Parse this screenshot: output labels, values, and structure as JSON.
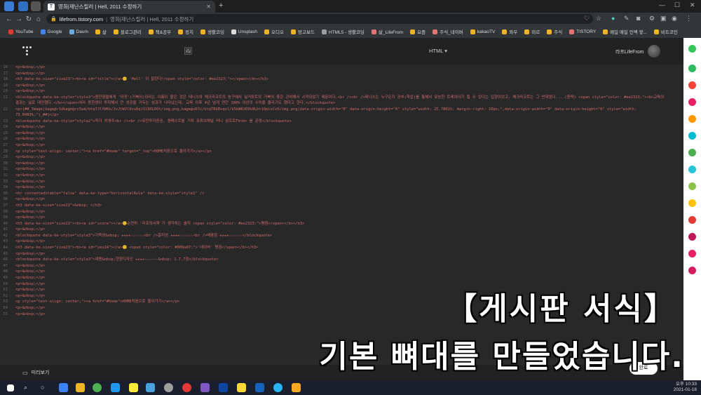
{
  "tab": {
    "title": "영화|재난스릴러 | Hell, 2011 수정하기",
    "favicon": "T"
  },
  "address": {
    "host": "lifefrom.tistory.com",
    "separator": "|",
    "page_title": "영화|재난스릴러 | Hell, 2011 수정하기"
  },
  "bookmarks": [
    {
      "label": "YouTube",
      "color": "#e53935"
    },
    {
      "label": "Google",
      "color": "#4285f4"
    },
    {
      "label": "Daum",
      "color": "#6fa8dc"
    },
    {
      "label": "삶",
      "color": "#f0b323"
    },
    {
      "label": "블로그관리",
      "color": "#f0b323"
    },
    {
      "label": "책&공부",
      "color": "#f0b323"
    },
    {
      "label": "정치",
      "color": "#f0b323"
    },
    {
      "label": "생활코딩",
      "color": "#f0b323"
    },
    {
      "label": "Unsplash",
      "color": "#dddddd"
    },
    {
      "label": "오디오",
      "color": "#f0b323"
    },
    {
      "label": "망고보드",
      "color": "#f0b323"
    },
    {
      "label": "HTML5 - 생활코딩",
      "color": "#9e9e9e"
    },
    {
      "label": "삶_LifeFrom",
      "color": "#e57373"
    },
    {
      "label": "요즘",
      "color": "#f0b323"
    },
    {
      "label": "주식_네이버",
      "color": "#e57373"
    },
    {
      "label": "kakaoTV",
      "color": "#f0b323"
    },
    {
      "label": "와우",
      "color": "#f0b323"
    },
    {
      "label": "미르",
      "color": "#f0b323"
    },
    {
      "label": "주식",
      "color": "#f0b323"
    },
    {
      "label": "TISTORY",
      "color": "#e57373"
    },
    {
      "label": "매일 매일 인맥 쌓...",
      "color": "#f0b323"
    },
    {
      "label": "비트코인",
      "color": "#f0b323"
    }
  ],
  "editor": {
    "mode_label": "HTML",
    "mode_caret": "▾",
    "user_name": "라프LifeFrom",
    "preview_label": "미리보기",
    "save_label": "완료"
  },
  "code_lines": [
    {
      "n": "16",
      "code": "<p>&nbsp;</p>"
    },
    {
      "n": "17",
      "code": "<p>&nbsp;</p>"
    },
    {
      "n": "18",
      "code": "<h3 data-ke-size=\"size23\"><b><a id=\"title\"></a>😊 'Hell' 이 말한다!<span style=\"color: #ee2323;\"></span></b></h3>"
    },
    {
      "n": "19",
      "code": "<p>&nbsp;</p>"
    },
    {
      "n": "20",
      "code": "<p>&nbsp;</p>"
    },
    {
      "n": "21",
      "code": "<blockquote data-ke-style=\"style3\">용한형들에게 '타겟'(거북이)이라는 이름이 붙은 것은 테니스와 헤크라코트의 농구에서 싫거포트의 거북이 좋은 관치해서 시작되었기 때문이다.<br /><br />테니스는 누구든지 공부(학습)를 통해서 유능한 트레이더가 될 수 있다는 입장이었고, 헤크라코트는 그 반대였다....(중략) <span style=\"color: #ee2323;\"><b>교육의 결과는 실로 대단했다.</b></span>여러 종한생이 투자해서 큰 성공을 거두는 성과가 나타났는데, 교육 이후 4년 넘게 연간 100% 이상의 수익을 올리기도 했다고 한다.</blockquote>",
      "wrap": true
    },
    {
      "n": "22",
      "code": "<p>[##_Image|kage@r1dkage@rc5wd/btqTJlYW6k/JvJtWJl9xvDqiSl9XLDOt/img.png,kage@sD7c/btqTRkBxqol/k5kW8JE9k0Lbt1QeisCzO/img.png|data-origin-width=\"0\" data-origin-height=\"0\" style=\"width: 25.7801%; margin-right: 10px;\",data-origin-width=\"0\" data-origin-height=\"0\" style=\"width: 73.0483%;\"|_##]</p>",
      "wrap": true
    },
    {
      "n": "23",
      "code": "<blockquote data-ke-style=\"style2\">작가 차영주<br /><br />유진투자증권, 퀀메스트를 거쳐 유튜브채널 러니 삼프로TV<b> 를 운영</blockquote>"
    },
    {
      "n": "24",
      "code": "<p>&nbsp;</p>"
    },
    {
      "n": "25",
      "code": "<p>&nbsp;</p>"
    },
    {
      "n": "26",
      "code": "<p>&nbsp;</p>"
    },
    {
      "n": "27",
      "code": "<p>&nbsp;</p>"
    },
    {
      "n": "28",
      "code": "<p style=\"text-align: center;\"><a href=\"#home\" target=\"_top\">HOME처음으로 돌아가기</a></p>"
    },
    {
      "n": "29",
      "code": "<p>&nbsp;</p>"
    },
    {
      "n": "30",
      "code": "<p>&nbsp;</p>"
    },
    {
      "n": "31",
      "code": "<p>&nbsp;</p>"
    },
    {
      "n": "32",
      "code": "<p>&nbsp;</p>"
    },
    {
      "n": "33",
      "code": "<p>&nbsp;</p>"
    },
    {
      "n": "34",
      "code": "<p>&nbsp;</p>"
    },
    {
      "n": "35",
      "code": "<hr contenteditable=\"false\" data-ke-type=\"horizontalRule\" data-ke-style=\"style1\" />"
    },
    {
      "n": "36",
      "code": "<p>&nbsp;</p>"
    },
    {
      "n": "37",
      "code": "<h3 data-ke-size=\"size23\">&nbsp; </h3>"
    },
    {
      "n": "38",
      "code": "<p>&nbsp;</p>"
    },
    {
      "n": "39",
      "code": "<p>&nbsp;</p>"
    },
    {
      "n": "40",
      "code": "<h3 data-ke-size=\"size23\"><b><a id=\"score\"></a>😊순전히 '라프의서재'가 생각하는 솔직 <span style=\"color: #ee2323;\">평점</span></b></h3>"
    },
    {
      "n": "41",
      "code": "<p>&nbsp;</p>"
    },
    {
      "n": "42",
      "code": "<blockquote data-ke-style=\"style3\">가독성&nbsp; ★★★★☆☆☆☆☆☆<br />흥미성 ★★★★☆☆☆☆☆☆<br />배움점 ★★★★☆☆☆☆☆☆</blockquote>"
    },
    {
      "n": "43",
      "code": "<p>&nbsp;</p>"
    },
    {
      "n": "44",
      "code": "<h3 data-ke-size=\"size23\"><b><a id=\"yes24\"></a>😊 <span style=\"color: #009a87;\">'네이버' 평점</span></b></h3>"
    },
    {
      "n": "45",
      "code": "<p>&nbsp;</p>"
    },
    {
      "n": "46",
      "code": "<blockquote data-ke-style=\"style3\">내용&nbsp;현장디자인 ★★★★☆☆☆☆☆☆&nbsp; 1.7.7점</blockquote>"
    },
    {
      "n": "47",
      "code": "<p>&nbsp;</p>"
    },
    {
      "n": "48",
      "code": "<p>&nbsp;</p>"
    },
    {
      "n": "49",
      "code": "<p>&nbsp;</p>"
    },
    {
      "n": "50",
      "code": "<p>&nbsp;</p>"
    },
    {
      "n": "51",
      "code": "<p>&nbsp;</p>"
    },
    {
      "n": "52",
      "code": "<p>&nbsp;</p>"
    },
    {
      "n": "53",
      "code": "<p style=\"text-align: center;\"><a href=\"#home\">HOME처음으로 돌아가기</a></p>"
    },
    {
      "n": "54",
      "code": "<p>&nbsp;</p>"
    },
    {
      "n": "55",
      "code": "<p>&nbsp;</p>"
    }
  ],
  "caption": {
    "line1": "【게시판 서식】",
    "line2": "기본 뼈대를 만들었습니다."
  },
  "clock": {
    "time": "오후 10:33",
    "date": "2021-01-18"
  },
  "colors": {
    "tag": "#d16a6a",
    "editor_bg": "#282828",
    "header_bg": "#222222"
  }
}
